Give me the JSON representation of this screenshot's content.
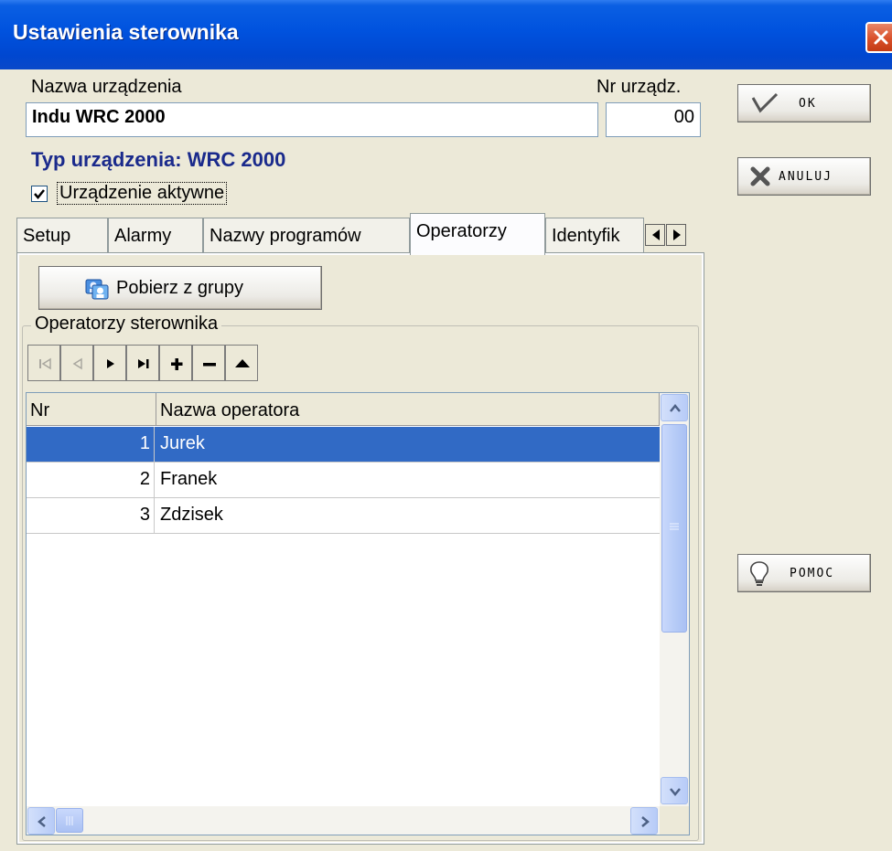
{
  "window": {
    "title": "Ustawienia sterownika"
  },
  "device": {
    "name_label": "Nazwa urządzenia",
    "name_value": "Indu WRC 2000",
    "number_label": "Nr urządz.",
    "number_value": "00",
    "type_text": "Typ urządzenia: WRC 2000",
    "active_label": "Urządzenie aktywne",
    "active_checked": true
  },
  "tabs": [
    {
      "label": "Setup"
    },
    {
      "label": "Alarmy"
    },
    {
      "label": "Nazwy programów"
    },
    {
      "label": "Operatorzy",
      "active": true
    },
    {
      "label": "Identyfik"
    }
  ],
  "panel": {
    "fetch_button": "Pobierz z grupy",
    "group_title": "Operatorzy sterownika",
    "nav_icons": [
      "first-icon",
      "prior-icon",
      "next-icon",
      "last-icon",
      "insert-icon",
      "delete-icon",
      "edit-icon"
    ]
  },
  "grid": {
    "columns": [
      "Nr",
      "Nazwa operatora"
    ],
    "rows": [
      {
        "nr": "1",
        "name": "Jurek",
        "selected": true
      },
      {
        "nr": "2",
        "name": "Franek",
        "selected": false
      },
      {
        "nr": "3",
        "name": "Zdzisek",
        "selected": false
      }
    ]
  },
  "buttons": {
    "ok": "OK",
    "cancel": "ANULUJ",
    "help": "POMOC"
  },
  "colors": {
    "titlebar": "#0052de",
    "selection": "#316ac5",
    "type_text": "#1a2a8c",
    "face": "#ece9d8"
  }
}
